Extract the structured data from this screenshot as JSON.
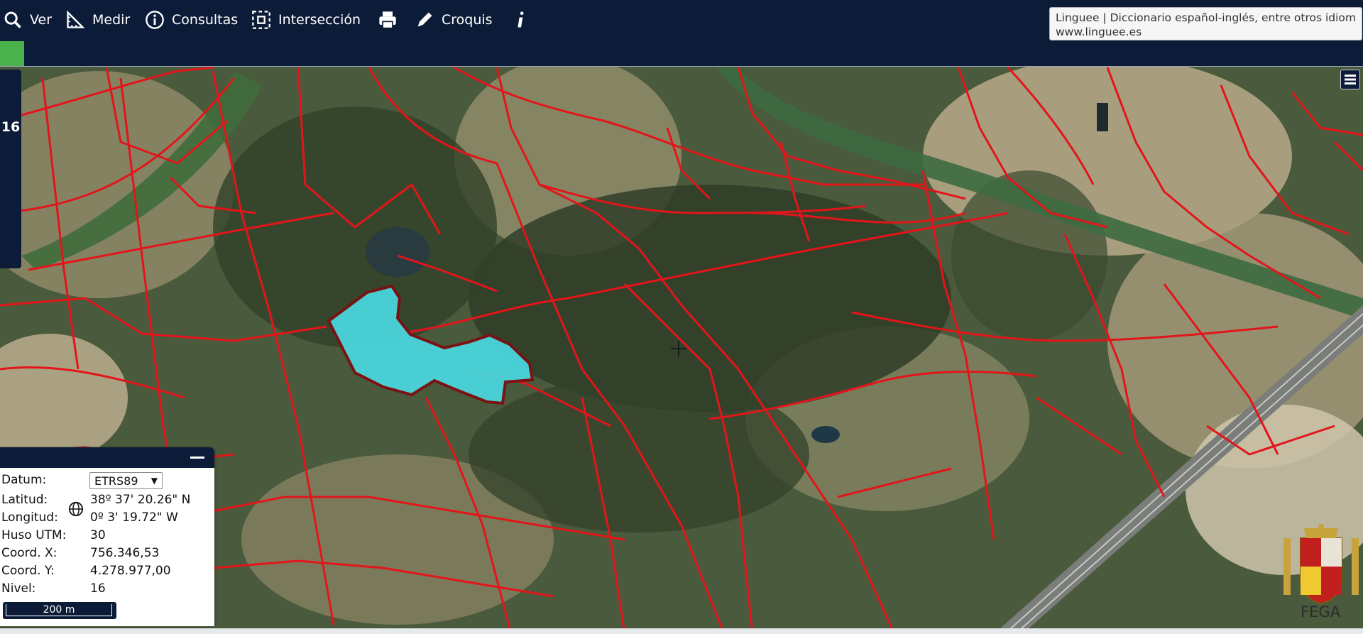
{
  "toolbar": {
    "items": [
      {
        "label": "Ver",
        "icon": "search-icon"
      },
      {
        "label": "Medir",
        "icon": "measure-icon"
      },
      {
        "label": "Consultas",
        "icon": "info-circle-icon"
      },
      {
        "label": "Intersección",
        "icon": "intersection-icon"
      },
      {
        "label": "",
        "icon": "print-icon"
      },
      {
        "label": "Croquis",
        "icon": "pencil-icon"
      },
      {
        "label": "",
        "icon": "info-icon"
      }
    ]
  },
  "tooltip": {
    "title": "Linguee | Diccionario español-inglés, entre otros idiomas",
    "url": "www.linguee.es"
  },
  "map": {
    "zoom_level": "16",
    "parcel_color": "#e3151a",
    "selected_parcel_color": "#49d5dc"
  },
  "coords": {
    "datum_label": "Datum:",
    "datum_value": "ETRS89",
    "lat_label": "Latitud:",
    "lat_value": "38º 37' 20.26\" N",
    "lon_label": "Longitud:",
    "lon_value": "0º 3' 19.72\" W",
    "utm_label": "Huso UTM:",
    "utm_value": "30",
    "x_label": "Coord. X:",
    "x_value": "756.346,53",
    "y_label": "Coord. Y:",
    "y_value": "4.278.977,00",
    "level_label": "Nivel:",
    "level_value": "16",
    "scale": "200 m"
  },
  "logo": {
    "text": "FEGA"
  }
}
